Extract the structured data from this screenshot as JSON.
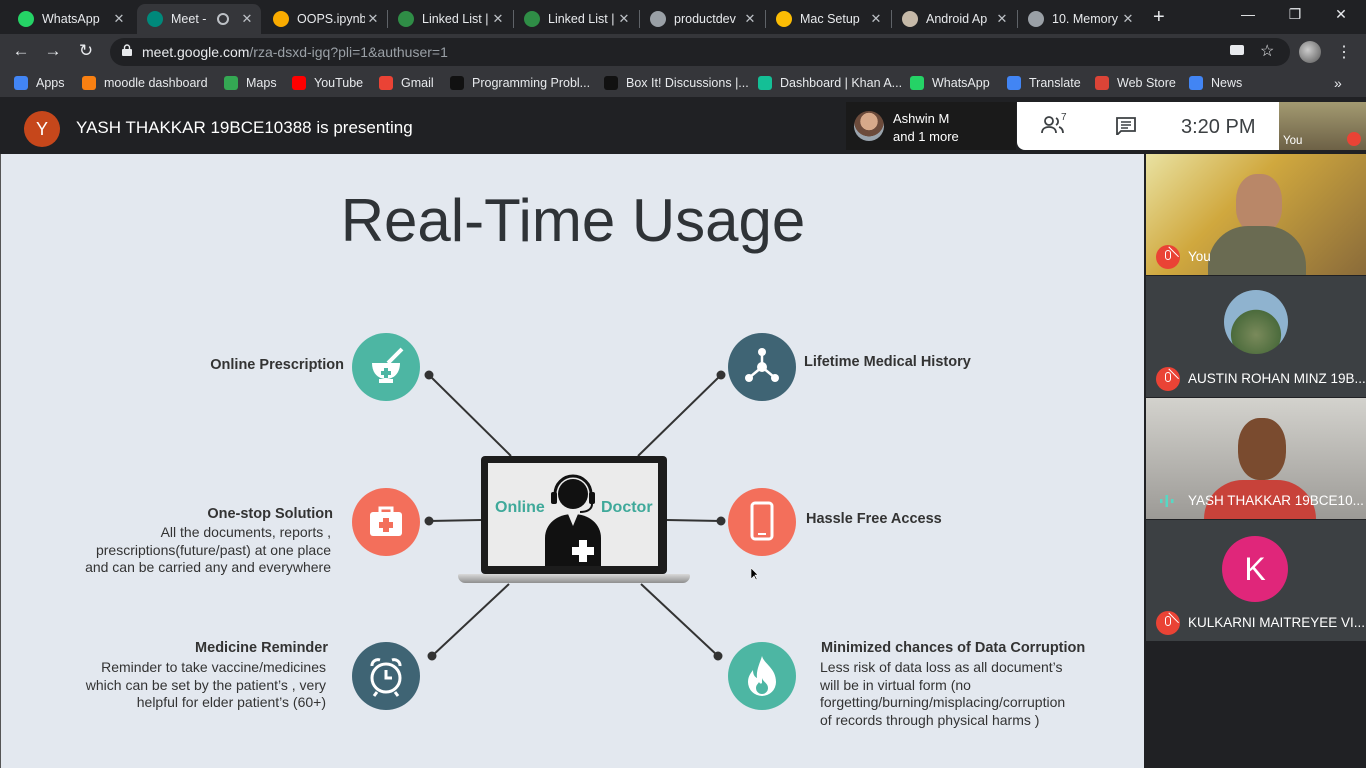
{
  "tabs": [
    {
      "title": "WhatsApp",
      "color": "#25d366",
      "active": false
    },
    {
      "title": "Meet -",
      "color": "#00897b",
      "active": true
    },
    {
      "title": "OOPS.ipynb",
      "color": "#f9ab00",
      "active": false
    },
    {
      "title": "Linked List |",
      "color": "#2f8d46",
      "active": false
    },
    {
      "title": "Linked List |",
      "color": "#2f8d46",
      "active": false
    },
    {
      "title": "productdev",
      "color": "#9aa0a6",
      "active": false
    },
    {
      "title": "Mac Setup",
      "color": "#fbbc04",
      "active": false
    },
    {
      "title": "Android Ap",
      "color": "#c5b9a8",
      "active": false
    },
    {
      "title": "10. Memory",
      "color": "#9aa0a6",
      "active": false
    }
  ],
  "window": {
    "minimize": "—",
    "restore": "❐",
    "close": "✕",
    "new_tab": "+"
  },
  "address": {
    "host": "meet.google.com",
    "path": "/rza-dsxd-igq?pli=1&authuser=1"
  },
  "bookmarks": [
    {
      "label": "Apps",
      "color": "#4285f4"
    },
    {
      "label": "moodle dashboard",
      "color": "#f98012"
    },
    {
      "label": "Maps",
      "color": "#34a853"
    },
    {
      "label": "YouTube",
      "color": "#ff0000"
    },
    {
      "label": "Gmail",
      "color": "#ea4335"
    },
    {
      "label": "Programming Probl...",
      "color": "#111111"
    },
    {
      "label": "Box It! Discussions |...",
      "color": "#111111"
    },
    {
      "label": "Dashboard | Khan A...",
      "color": "#14bf96"
    },
    {
      "label": "WhatsApp",
      "color": "#25d366"
    },
    {
      "label": "Translate",
      "color": "#4285f4"
    },
    {
      "label": "Web Store",
      "color": "#db4437"
    },
    {
      "label": "News",
      "color": "#4285f4"
    }
  ],
  "meet": {
    "presenter_initial": "Y",
    "presenter_title": "YASH THAKKAR 19BCE10388 is presenting",
    "others": {
      "name": "Ashwin M",
      "more": "and 1 more"
    },
    "people_count": "7",
    "time": "3:20 PM",
    "self_label": "You"
  },
  "slide": {
    "title": "Real-Time Usage",
    "laptop": {
      "left": "Online",
      "right": "Doctor"
    },
    "items": [
      {
        "label": "Online Prescription",
        "desc": []
      },
      {
        "label": "Lifetime Medical History",
        "desc": []
      },
      {
        "label": "One-stop Solution",
        "desc": [
          "All the documents, reports ,",
          "prescriptions(future/past) at one place",
          "and can be carried any and everywhere"
        ]
      },
      {
        "label": "Hassle Free Access",
        "desc": []
      },
      {
        "label": "Medicine Reminder",
        "desc": [
          "Reminder to take vaccine/medicines",
          "which can be set by the patient’s , very",
          "helpful for elder patient’s (60+)"
        ]
      },
      {
        "label": "Minimized chances of Data Corruption",
        "desc": [
          "Less risk of data loss as all document’s",
          "will be in virtual form (no",
          "forgetting/burning/misplacing/corruption",
          "of records through physical harms )"
        ]
      }
    ]
  },
  "participants": [
    {
      "name": "You"
    },
    {
      "name": "AUSTIN ROHAN MINZ 19B..."
    },
    {
      "name": "YASH THAKKAR 19BCE10..."
    },
    {
      "name": "KULKARNI MAITREYEE VI...",
      "initial": "K"
    }
  ]
}
